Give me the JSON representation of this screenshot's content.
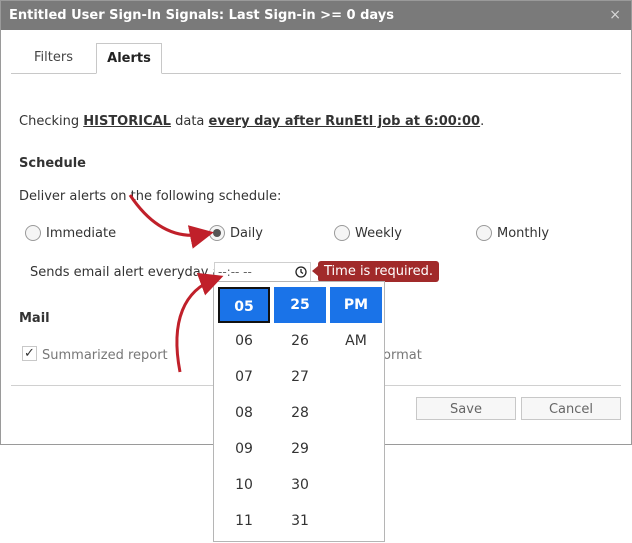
{
  "dialog": {
    "title": "Entitled User Sign-In Signals: Last Sign-in >= 0 days",
    "close_icon": "×"
  },
  "tabs": [
    "Filters",
    "Alerts"
  ],
  "checking": {
    "pre": "Checking",
    "mode": "HISTORICAL",
    "mid": "data",
    "schedule": "every day after RunEtl job at 6:00:00",
    "end": "."
  },
  "schedule": {
    "heading": "Schedule",
    "description": "Deliver alerts on the following schedule:",
    "options": [
      "Immediate",
      "Daily",
      "Weekly",
      "Monthly"
    ],
    "selected": "Daily",
    "sends_label": "Sends email alert everyday at",
    "time_value": "--:-- --",
    "error": "Time is required."
  },
  "mail": {
    "heading": "Mail",
    "summarized_label": "Summarized report",
    "format_label": "ormat"
  },
  "buttons": {
    "save": "Save",
    "cancel": "Cancel"
  },
  "picker": {
    "hours": [
      "05",
      "06",
      "07",
      "08",
      "09",
      "10",
      "11"
    ],
    "minutes": [
      "25",
      "26",
      "27",
      "28",
      "29",
      "30",
      "31"
    ],
    "ampm": [
      "PM",
      "AM"
    ]
  },
  "colors": {
    "accent": "#1a73e8",
    "error": "#a12a2a",
    "arrow": "#c0202a",
    "titlebar": "#7a7a7a"
  }
}
